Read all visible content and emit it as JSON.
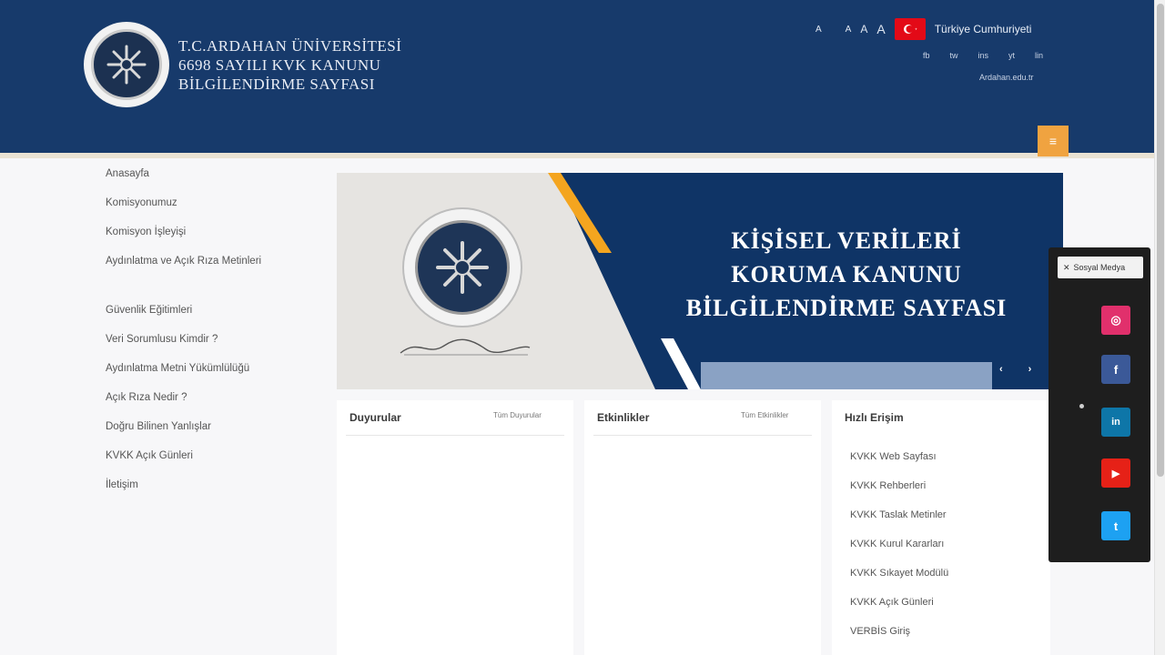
{
  "header": {
    "logo_lines": [
      "T.C.ARDAHAN ÜNİVERSİTESİ",
      "6698 SAYILI KVK KANUNU",
      "BİLGİLENDİRME SAYFASI"
    ],
    "font_small": "A",
    "font_mid": "A",
    "font_large": "A",
    "font_reset": "A",
    "lang_label": "Türkiye Cumhuriyeti",
    "social_links": [
      "fb",
      "tw",
      "ins",
      "yt",
      "lin"
    ],
    "site_link": "Ardahan.edu.tr",
    "menu_icon": "menu-icon",
    "menu_symbol": "≡"
  },
  "sidebar": {
    "items": [
      {
        "label": "Anasayfa"
      },
      {
        "label": "Komisyonumuz"
      },
      {
        "label": "Komisyon İşleyişi"
      },
      {
        "label": "Aydınlatma ve Açık Rıza Metinleri"
      },
      {
        "label": "Güvenlik Eğitimleri"
      },
      {
        "label": "Veri Sorumlusu Kimdir ?"
      },
      {
        "label": "Aydınlatma Metni Yükümlülüğü"
      },
      {
        "label": "Açık Rıza Nedir ?"
      },
      {
        "label": "Doğru Bilinen Yanlışlar"
      },
      {
        "label": "KVKK Açık Günleri"
      },
      {
        "label": "İletişim"
      }
    ]
  },
  "banner": {
    "title_lines": [
      "KİŞİSEL VERİLERİ",
      "KORUMA KANUNU",
      "BİLGİLENDİRME SAYFASI"
    ],
    "prev": "‹",
    "next": "›"
  },
  "panels": {
    "duyurular": {
      "title": "Duyurular",
      "more": "Tüm Duyurular"
    },
    "etkinlikler": {
      "title": "Etkinlikler",
      "more": "Tüm Etkinlikler"
    },
    "hizli_erisim": {
      "title": "Hızlı Erişim",
      "items": [
        "KVKK Web Sayfası",
        "KVKK Rehberleri",
        "KVKK Taslak Metinler",
        "KVKK Kurul Kararları",
        "KVKK Sıkayet Modülü",
        "KVKK Açık Günleri",
        "VERBİS Giriş"
      ]
    }
  },
  "social_float": {
    "toggle_label": "Sosyal Medya",
    "buttons": [
      {
        "name": "instagram",
        "glyph": "◎",
        "color": "#e1306c"
      },
      {
        "name": "facebook",
        "glyph": "f",
        "color": "#3b5998"
      },
      {
        "name": "linkedin",
        "glyph": "in",
        "color": "#0e76a8"
      },
      {
        "name": "youtube",
        "glyph": "▶",
        "color": "#e62117"
      },
      {
        "name": "twitter",
        "glyph": "t",
        "color": "#1da1f2"
      }
    ]
  },
  "colors": {
    "header": "#173a6b",
    "accent": "#f0a340",
    "banner_blue": "#0f3466",
    "banner_gold": "#f4a51f"
  }
}
